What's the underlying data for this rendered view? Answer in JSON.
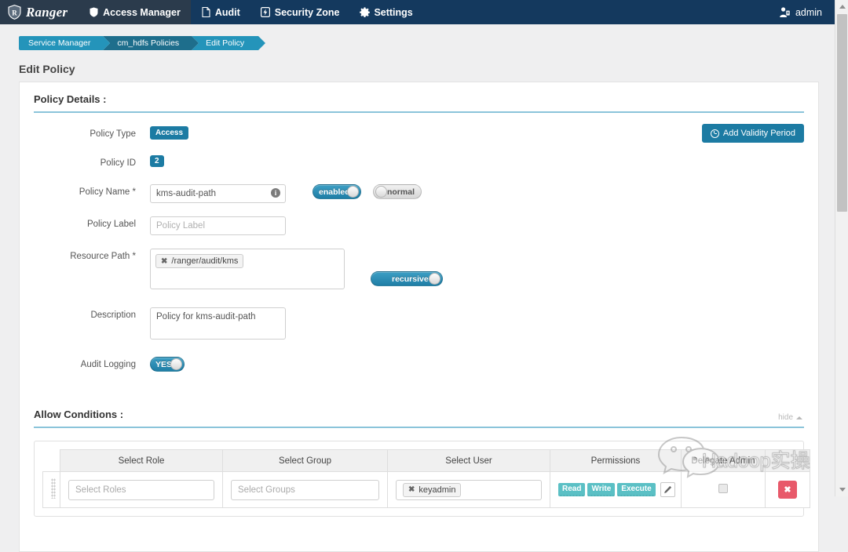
{
  "nav": {
    "brand": "Ranger",
    "items": [
      {
        "label": "Access Manager",
        "icon": "shield-icon",
        "active": true
      },
      {
        "label": "Audit",
        "icon": "file-icon",
        "active": false
      },
      {
        "label": "Security Zone",
        "icon": "bolt-icon",
        "active": false
      },
      {
        "label": "Settings",
        "icon": "gear-icon",
        "active": false
      }
    ],
    "user": "admin"
  },
  "breadcrumb": [
    "Service Manager",
    "cm_hdfs Policies",
    "Edit Policy"
  ],
  "page_title": "Edit Policy",
  "policy_details": {
    "section_title": "Policy Details :",
    "add_validity_label": "Add Validity Period",
    "policy_type_label": "Policy Type",
    "policy_type_value": "Access",
    "policy_id_label": "Policy ID",
    "policy_id_value": "2",
    "policy_name_label": "Policy Name *",
    "policy_name_value": "kms-audit-path",
    "policy_enabled_toggle": "enabled",
    "policy_priority_toggle": "normal",
    "policy_label_label": "Policy Label",
    "policy_label_placeholder": "Policy Label",
    "resource_path_label": "Resource Path *",
    "resource_path_tag": "/ranger/audit/kms",
    "recursive_toggle": "recursive",
    "description_label": "Description",
    "description_value": "Policy for kms-audit-path",
    "audit_logging_label": "Audit Logging",
    "audit_logging_toggle": "YES"
  },
  "allow_conditions": {
    "section_title": "Allow Conditions :",
    "hide_label": "hide",
    "columns": [
      "Select Role",
      "Select Group",
      "Select User",
      "Permissions",
      "Delegate Admin",
      ""
    ],
    "rows": [
      {
        "role_placeholder": "Select Roles",
        "group_placeholder": "Select Groups",
        "user_tag": "keyadmin",
        "permissions": [
          "Read",
          "Write",
          "Execute"
        ],
        "delegate_admin": false,
        "delete_label": "✖"
      }
    ]
  },
  "watermark": "Hadoop实操",
  "colors": {
    "nav_bg": "#14395e",
    "nav_active": "#2b3b4c",
    "accent": "#1c7ba3",
    "crumb": "#2494ba",
    "crumb_active": "#1e6e8c",
    "permission": "#5bc0c5",
    "delete": "#e8596a"
  }
}
